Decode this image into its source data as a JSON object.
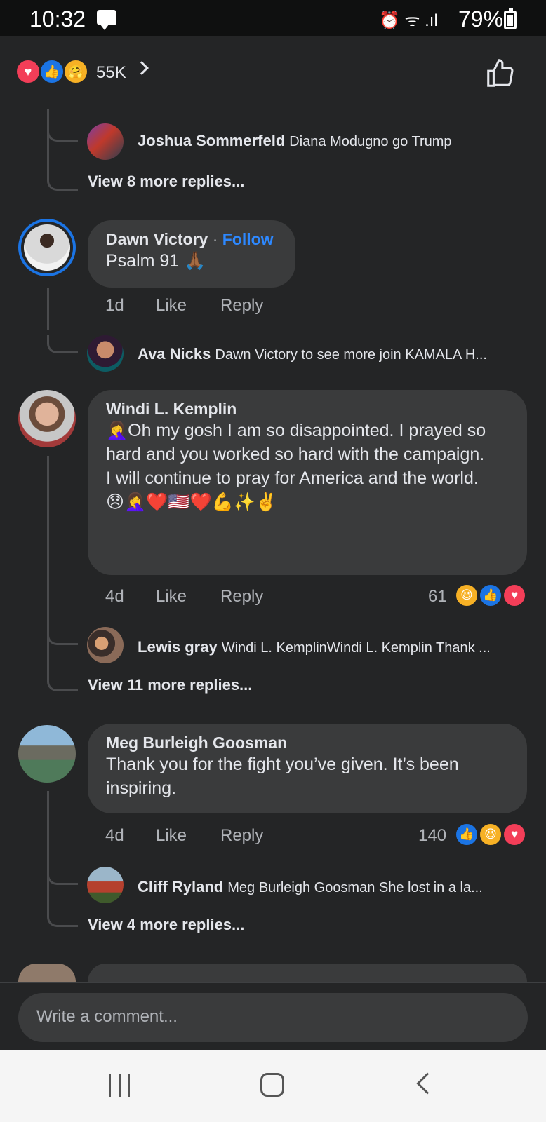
{
  "status_bar": {
    "time": "10:32",
    "icons": "⏰ ᯤ .ıl",
    "battery": "79%"
  },
  "header": {
    "reactions": [
      "love",
      "like",
      "care"
    ],
    "count": "55K"
  },
  "thread_top": {
    "reply": {
      "name": "Joshua Sommerfeld",
      "text": "Diana Modugno go Trump"
    },
    "view_more": "View 8 more replies..."
  },
  "comments": [
    {
      "name": "Dawn Victory",
      "separator": "·",
      "follow": "Follow",
      "text": "Psalm 91 🙏🏾",
      "time": "1d",
      "like": "Like",
      "reply": "Reply",
      "reply_preview": {
        "name": "Ava Nicks",
        "text": "Dawn Victory to see more join KAMALA H..."
      }
    },
    {
      "name": "Windi L. Kemplin",
      "text": "🤦‍♀️Oh my gosh I am so disappointed. I prayed so hard and you worked so hard with the campaign.\nI will continue to pray for America and the world.\n😞🤦‍♀️❤️🇺🇸❤️💪✨✌️",
      "time": "4d",
      "like": "Like",
      "reply": "Reply",
      "reaction_count": "61",
      "reactions": [
        "haha",
        "like",
        "love"
      ],
      "reply_preview": {
        "name": "Lewis gray",
        "text": "Windi L. KemplinWindi L. Kemplin Thank ..."
      },
      "view_more": "View 11 more replies..."
    },
    {
      "name": "Meg Burleigh Goosman",
      "text": "Thank you for the fight you’ve given. It’s been inspiring.",
      "time": "4d",
      "like": "Like",
      "reply": "Reply",
      "reaction_count": "140",
      "reactions": [
        "like",
        "haha",
        "love"
      ],
      "reply_preview": {
        "name": "Cliff Ryland",
        "text": "Meg Burleigh Goosman She lost  in a la..."
      },
      "view_more": "View 4 more replies..."
    }
  ],
  "composer": {
    "placeholder": "Write a comment..."
  },
  "colors": {
    "background": "#242526",
    "bubble": "#3a3b3c",
    "accent": "#2d88ff",
    "love": "#f33e58",
    "like": "#1b74e4",
    "haha": "#f7b125"
  }
}
